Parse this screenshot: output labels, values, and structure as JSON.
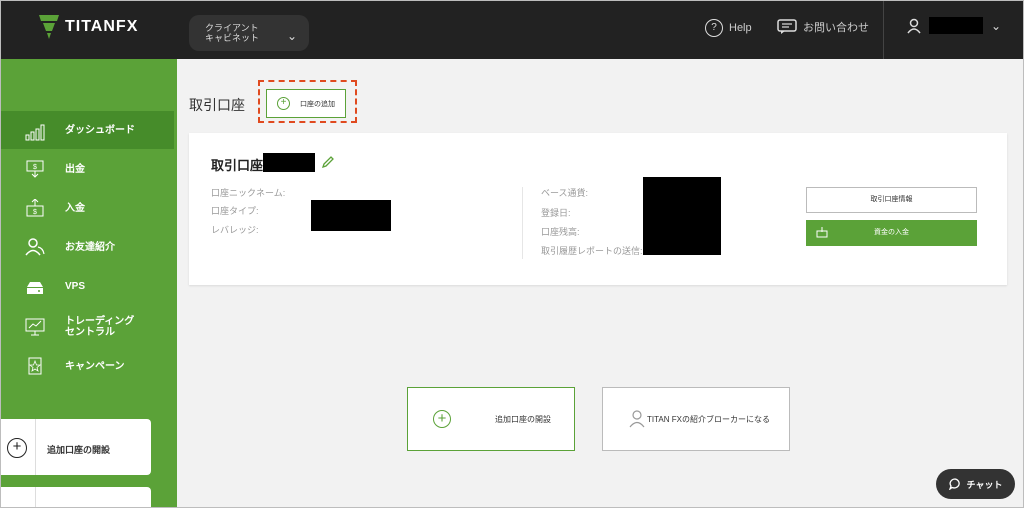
{
  "header": {
    "brand": "TITANFX",
    "cabinet_label": "クライアント\nキャビネット",
    "help_label": "Help",
    "contact_label": "お問い合わせ"
  },
  "sidebar": {
    "items": [
      {
        "label": "ダッシュボード",
        "icon": "bar-chart-icon"
      },
      {
        "label": "出金",
        "icon": "withdraw-icon"
      },
      {
        "label": "入金",
        "icon": "deposit-icon"
      },
      {
        "label": "お友達紹介",
        "icon": "users-icon"
      },
      {
        "label": "VPS",
        "icon": "server-icon"
      },
      {
        "label": "トレーディング\nセントラル",
        "icon": "monitor-chart-icon"
      },
      {
        "label": "キャンペーン",
        "icon": "campaign-icon"
      }
    ],
    "open_account_label": "追加口座の開設"
  },
  "main": {
    "heading": "取引口座",
    "add_account_label": "口座の追加",
    "account": {
      "title": "取引口座",
      "left_labels": [
        "口座ニックネーム:",
        "口座タイプ:",
        "レバレッジ:"
      ],
      "right_labels": [
        "ベース通貨:",
        "登録日:",
        "口座残高:",
        "取引履歴レポートの送信:"
      ],
      "info_button": "取引口座情報",
      "deposit_button": "資金の入金"
    },
    "open_account_button": "追加口座の開設",
    "broker_button": "TITAN FXの紹介ブローカーになる"
  },
  "chat": {
    "label": "チャット"
  },
  "colors": {
    "accent": "#5ba238",
    "dark": "#222222",
    "highlight": "#e04a1f"
  }
}
